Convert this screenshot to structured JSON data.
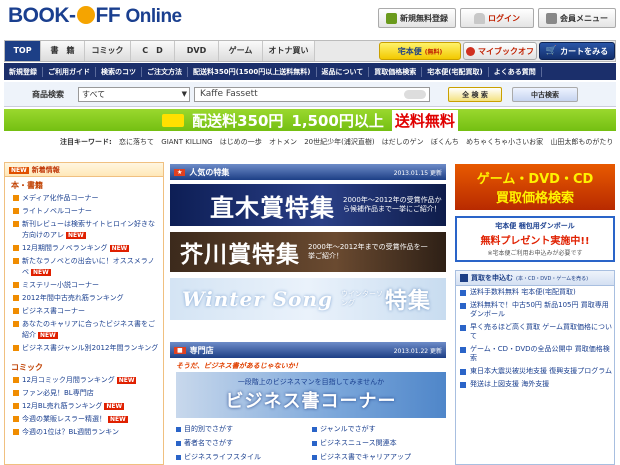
{
  "header": {
    "logo_book": "BOOK",
    "logo_dash": "-",
    "logo_off": "FF",
    "logo_online": "Online",
    "register": "新規無料登録",
    "login": "ログイン",
    "member_menu": "会員メニュー"
  },
  "nav": {
    "tabs": [
      "TOP",
      "書　籍",
      "コミック",
      "C　D",
      "DVD",
      "ゲーム",
      "オトナ買い"
    ],
    "takuhai": "宅本便",
    "takuhai_sub": "(無料)",
    "my_bookoff": "マイブックオフ",
    "cart": "カートをみる"
  },
  "subnav": [
    "新規登録",
    "ご利用ガイド",
    "検索のコツ",
    "ご注文方法",
    "配送料350円(1500円以上送料無料)",
    "返品について",
    "買取価格検索",
    "宅本便(宅配買取)",
    "よくある質問"
  ],
  "search": {
    "label": "商品検索",
    "category": "すべて",
    "query": "Kaffe Fassett",
    "search_btn": "全 検 索",
    "used_btn": "中古検索"
  },
  "shipping": {
    "label": "配送料350円",
    "over": "1,500円以上",
    "free": "送料無料"
  },
  "keywords": {
    "label": "注目キーワード:",
    "items": [
      "恋に落ちて",
      "GIANT KILLING",
      "はじめの一歩",
      "オトメン",
      "20世紀少年(浦沢直樹)",
      "はだしのゲン",
      "ぼくんち",
      "めちゃくちゃ小さいお家",
      "山田太郎ものがたり"
    ]
  },
  "left": {
    "header": "新着情報",
    "sec_books": "本・書籍",
    "books": [
      {
        "text": "メディア化作品コーナー",
        "new": false
      },
      {
        "text": "ライトノベルコーナー",
        "new": false
      },
      {
        "text": "新刊レビューは検索サイトヒロイン好きな方向けのアレ",
        "new": true
      },
      {
        "text": "12月期間ラノベランキング",
        "new": true
      },
      {
        "text": "新たなラノベとの出会いに！オススメラノベ",
        "new": true
      },
      {
        "text": "ミステリー小説コーナー",
        "new": false
      },
      {
        "text": "2012年間中古売れ筋ランキング",
        "new": false
      },
      {
        "text": "ビジネス書コーナー",
        "new": false
      },
      {
        "text": "あなたのキャリアに合ったビジネス書をご紹介",
        "new": true
      },
      {
        "text": "ビジネス書ジャンル別2012年間ランキング",
        "new": false
      }
    ],
    "sec_comics": "コミック",
    "comics": [
      {
        "text": "12月コミック月間ランキング",
        "new": true
      },
      {
        "text": "ファン必見！BL専門店",
        "new": false
      },
      {
        "text": "12月BL売れ筋ランキング",
        "new": true
      },
      {
        "text": "今週の業販レスラー精選！",
        "new": true
      },
      {
        "text": "今週の1位は？BL週間ランキン",
        "new": false
      }
    ],
    "new_label": "NEW"
  },
  "center": {
    "feature_title": "人気の特集",
    "feature_date": "2013.01.15 更新",
    "naoki": "直木賞特集",
    "naoki_sub": "2000年～2012年の受賞作品から候補作品まで一挙にご紹介！",
    "akuta": "芥川賞特集",
    "akuta_sub": "2000年～2012年までの受賞作品を一挙ご紹介！",
    "winter_en": "Winter Song",
    "winter_jp": "ウインターソング",
    "winter_tk": "特集",
    "shop_title": "専門店",
    "shop_date": "2013.01.22 更新",
    "biz_tag": "そうだ、ビジネス書があるじゃないか！",
    "biz_sub": "一段階上のビジネスマンを目指してみませんか",
    "biz_title": "ビジネス書コーナー",
    "links": [
      "目的別でさがす",
      "ジャンルでさがす",
      "著者名でさがす",
      "ビジネスニュース関連本",
      "ビジネスライフスタイル",
      "ビジネス書でキャリアアップ"
    ]
  },
  "right": {
    "game_title": "ゲーム・DVD・CD",
    "game_sub": "買取価格検索",
    "box_line1": "宅本便 梱包用ダンボール",
    "box_line2": "無料プレゼント実施中!!",
    "box_line3": "※宅本便ご利用お申込みが必要です",
    "buy_header": "買取を申込む",
    "buy_header_sub": "(本・CD・DVD・ゲームを売る)",
    "links": [
      "送料手数料無料 宅本便(宅配買取)",
      "送料無料で！中古50円 新品105円 買取専用ダンボール",
      "早く売るほど高く買取 ゲーム買取価格について",
      "ゲーム・CD・DVDの全品公開中 買取価格検索",
      "東日本大震災被災地支援 復興支援プログラム",
      "発送は上図支援 海外支援"
    ]
  }
}
